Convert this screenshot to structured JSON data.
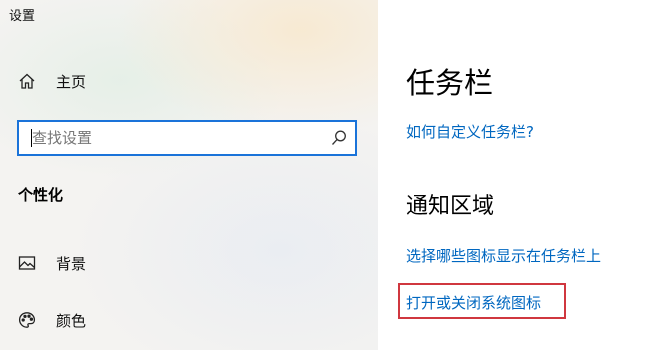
{
  "window": {
    "title": "设置"
  },
  "sidebar": {
    "home": {
      "label": "主页",
      "icon": "home-icon"
    },
    "search": {
      "placeholder": "查找设置",
      "value": "",
      "icon": "search-icon"
    },
    "section": "个性化",
    "items": [
      {
        "label": "背景",
        "icon": "picture-icon"
      },
      {
        "label": "颜色",
        "icon": "palette-icon"
      }
    ]
  },
  "main": {
    "title": "任务栏",
    "customize_link": "如何自定义任务栏?",
    "notification_area": {
      "heading": "通知区域",
      "links": [
        "选择哪些图标显示在任务栏上",
        "打开或关闭系统图标"
      ]
    }
  },
  "colors": {
    "accent": "#0067c0",
    "focus_border": "#1a73d9",
    "highlight": "#d0373f"
  }
}
